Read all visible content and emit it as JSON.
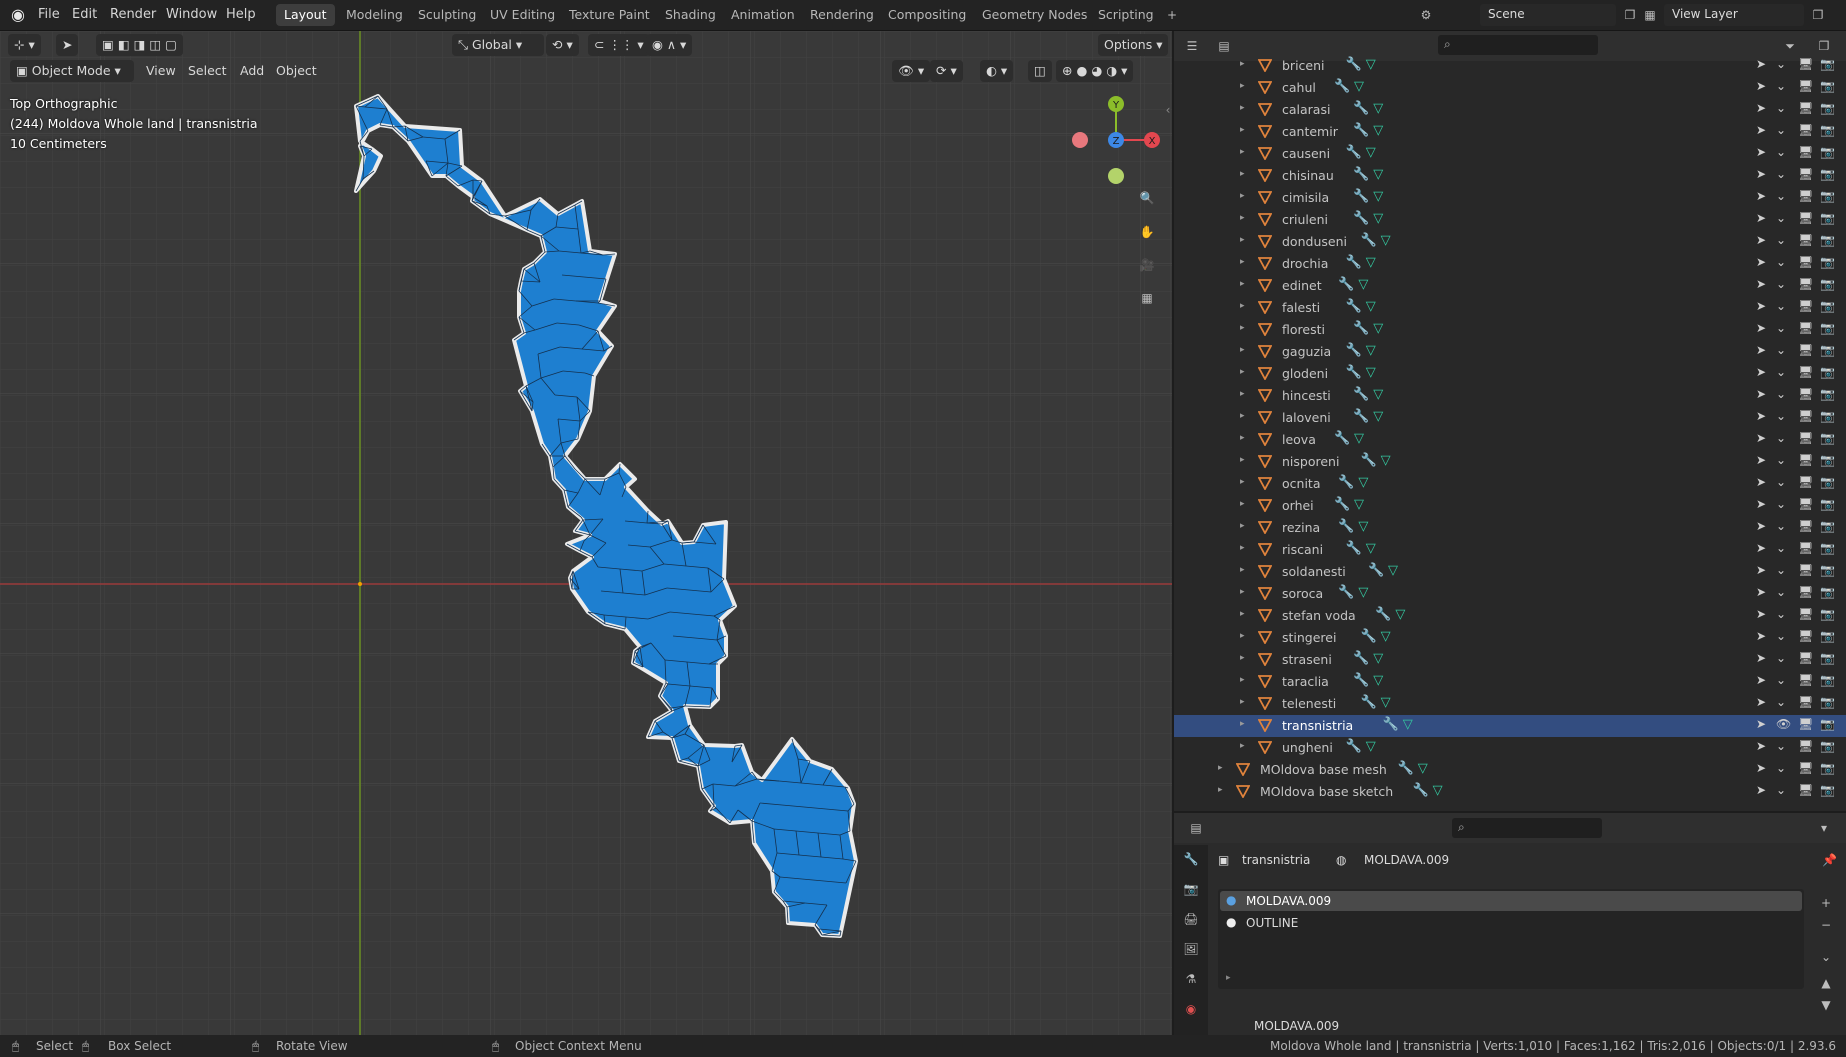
{
  "menu": [
    "File",
    "Edit",
    "Render",
    "Window",
    "Help"
  ],
  "workspaces": [
    "Layout",
    "Modeling",
    "Sculpting",
    "UV Editing",
    "Texture Paint",
    "Shading",
    "Animation",
    "Rendering",
    "Compositing",
    "Geometry Nodes",
    "Scripting"
  ],
  "scene": "Scene",
  "view_layer": "View Layer",
  "viewport": {
    "transform_orientation": "Global",
    "options_label": "Options",
    "mode": "Object Mode",
    "menus": [
      "View",
      "Select",
      "Add",
      "Object"
    ],
    "overlay_lines": [
      "Top Orthographic",
      "(244) Moldova Whole land | transnistria",
      "10 Centimeters"
    ],
    "gizmo_axes": [
      "Y",
      "Z",
      "X"
    ]
  },
  "outliner": {
    "items": [
      "briceni",
      "cahul",
      "calarasi",
      "cantemir",
      "causeni",
      "chisinau",
      "cimisila",
      "criuleni",
      "donduseni",
      "drochia",
      "edinet",
      "falesti",
      "floresti",
      "gaguzia",
      "glodeni",
      "hincesti",
      "laloveni",
      "leova",
      "nisporeni",
      "ocnita",
      "orhei",
      "rezina",
      "riscani",
      "soldanesti",
      "soroca",
      "stefan voda",
      "stingerei",
      "straseni",
      "taraclia",
      "telenesti",
      "transnistria",
      "ungheni"
    ],
    "selected": "transnistria",
    "parents": [
      "MOldova base mesh",
      "MOldova base sketch"
    ]
  },
  "properties": {
    "object_name": "transnistria",
    "material_name": "MOLDAVA.009",
    "slots": [
      "MOLDAVA.009",
      "OUTLINE"
    ],
    "bottom_field": "MOLDAVA.009"
  },
  "statusbar": {
    "select": "Select",
    "box_select": "Box Select",
    "rotate": "Rotate View",
    "context": "Object Context Menu",
    "stats": "Moldova Whole land | transnistria | Verts:1,010 | Faces:1,162 | Tris:2,016 | Objects:0/1 | 2.93.6"
  },
  "colors": {
    "mesh_fill": "#1e7fd0",
    "mesh_outline": "#e8e8e8",
    "selected_row": "#334d80",
    "x_axis": "#e2474f",
    "y_axis": "#8cbd2a",
    "z_axis": "#3d88e6"
  }
}
